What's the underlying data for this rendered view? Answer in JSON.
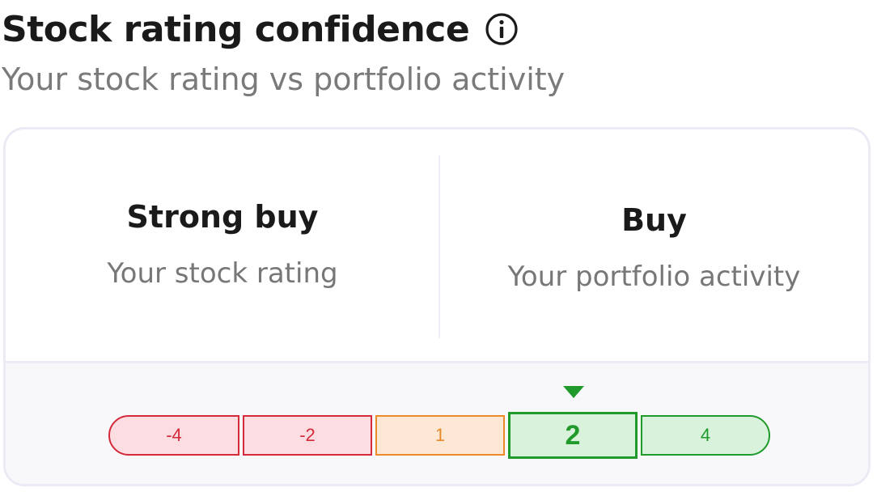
{
  "header": {
    "title": "Stock rating confidence",
    "subtitle": "Your stock rating vs portfolio activity"
  },
  "comparison": {
    "stock_rating": {
      "value": "Strong buy",
      "label": "Your stock rating"
    },
    "portfolio_activity": {
      "value": "Buy",
      "label": "Your portfolio activity"
    }
  },
  "scale": {
    "segments": [
      {
        "label": "-4",
        "tone": "red"
      },
      {
        "label": "-2",
        "tone": "red"
      },
      {
        "label": "1",
        "tone": "orange"
      },
      {
        "label": "2",
        "tone": "green"
      },
      {
        "label": "4",
        "tone": "green"
      }
    ],
    "selected_value": "2"
  },
  "colors": {
    "red": "#d42a3a",
    "orange": "#ea8a2a",
    "green": "#1f9a2b",
    "muted_text": "#777777",
    "border": "#eceaf4"
  },
  "icons": {
    "info": "info-circle-icon",
    "marker": "triangle-down-icon"
  }
}
